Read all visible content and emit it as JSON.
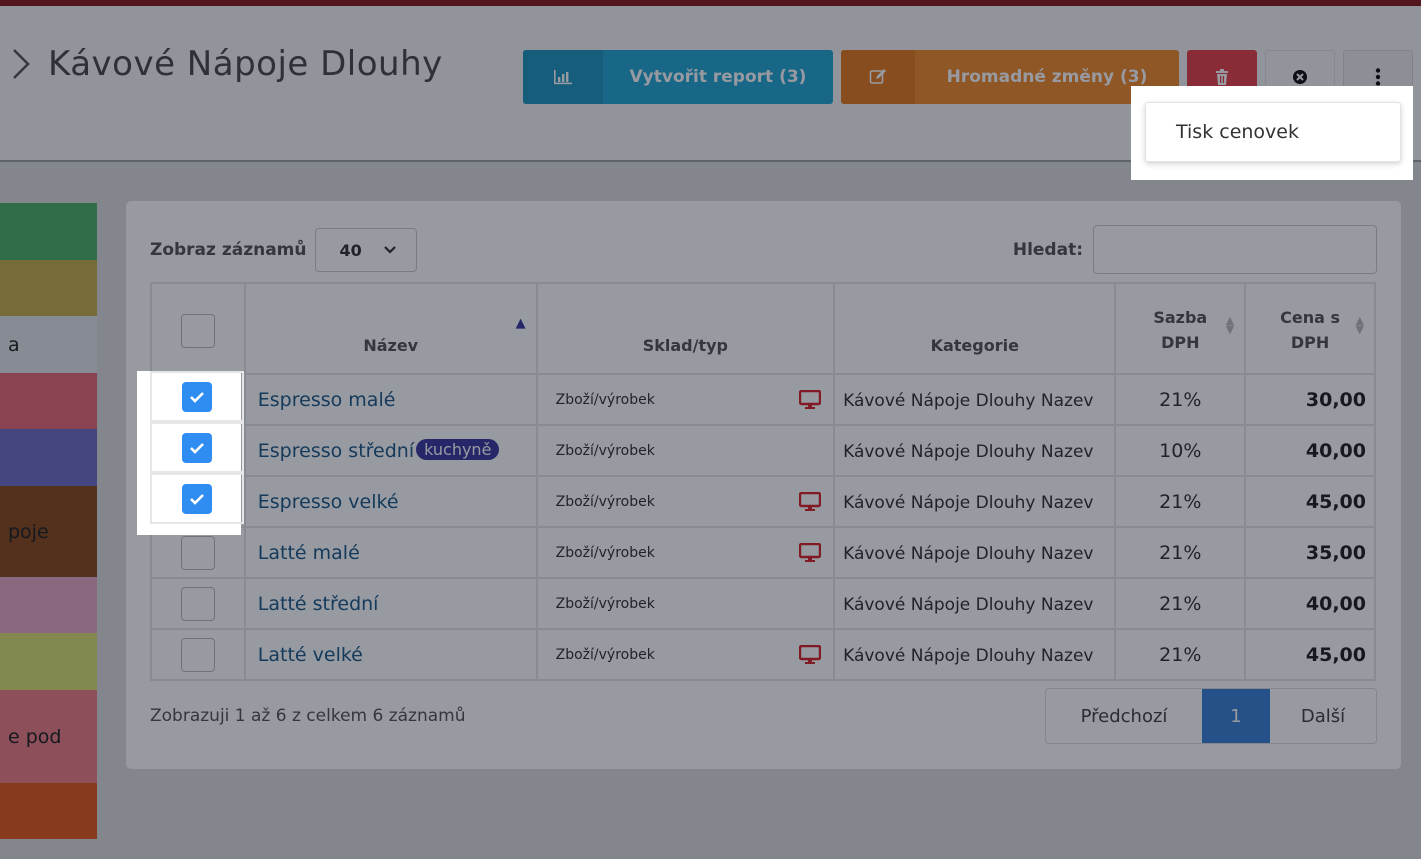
{
  "header": {
    "title": "Kávové Nápoje Dlouhy"
  },
  "toolbar": {
    "report_label": "Vytvořit report (3)",
    "bulk_label": "Hromadné změny (3)"
  },
  "dropdown": {
    "item": "Tisk cenovek"
  },
  "left_categories": [
    {
      "label": "",
      "color": "#4fb46a"
    },
    {
      "label": "",
      "color": "#c7b04a"
    },
    {
      "label": "a",
      "color": "#e4e6e8"
    },
    {
      "label": "",
      "color": "#e86b78"
    },
    {
      "label": "",
      "color": "#6e6fc6"
    },
    {
      "label": "poje",
      "color": "#8a4a1c"
    },
    {
      "label": "",
      "color": "#e9a9c3"
    },
    {
      "label": "",
      "color": "#dde073"
    },
    {
      "label": "e pod",
      "color": "#ee7f86"
    },
    {
      "label": "",
      "color": "#e45a20"
    }
  ],
  "table": {
    "show_label": "Zobraz záznamů",
    "show_value": "40",
    "search_label": "Hledat:",
    "columns": {
      "name": "Název",
      "sklad": "Sklad/typ",
      "kategorie": "Kategorie",
      "sazba": "Sazba DPH",
      "cena": "Cena s DPH"
    },
    "rows": [
      {
        "name": "Espresso malé",
        "badge": "",
        "sklad": "Zboží/výrobek",
        "monitor": true,
        "kategorie": "Kávové Nápoje Dlouhy Nazev",
        "sazba": "21%",
        "cena": "30,00",
        "checked": true
      },
      {
        "name": "Espresso střední",
        "badge": "kuchyně",
        "sklad": "Zboží/výrobek",
        "monitor": false,
        "kategorie": "Kávové Nápoje Dlouhy Nazev",
        "sazba": "10%",
        "cena": "40,00",
        "checked": true
      },
      {
        "name": "Espresso velké",
        "badge": "",
        "sklad": "Zboží/výrobek",
        "monitor": true,
        "kategorie": "Kávové Nápoje Dlouhy Nazev",
        "sazba": "21%",
        "cena": "45,00",
        "checked": true
      },
      {
        "name": "Latté malé",
        "badge": "",
        "sklad": "Zboží/výrobek",
        "monitor": true,
        "kategorie": "Kávové Nápoje Dlouhy Nazev",
        "sazba": "21%",
        "cena": "35,00",
        "checked": false
      },
      {
        "name": "Latté střední",
        "badge": "",
        "sklad": "Zboží/výrobek",
        "monitor": false,
        "kategorie": "Kávové Nápoje Dlouhy Nazev",
        "sazba": "21%",
        "cena": "40,00",
        "checked": false
      },
      {
        "name": "Latté velké",
        "badge": "",
        "sklad": "Zboží/výrobek",
        "monitor": true,
        "kategorie": "Kávové Nápoje Dlouhy Nazev",
        "sazba": "21%",
        "cena": "45,00",
        "checked": false
      }
    ],
    "info": "Zobrazuji 1 až 6 z celkem 6 záznamů",
    "pagination": {
      "prev": "Předchozí",
      "current": "1",
      "next": "Další"
    }
  },
  "colors": {
    "accent_link": "#1f5b8a",
    "report_button": "#25a8d3",
    "bulk_button": "#f28a2e",
    "delete_button": "#e8434a",
    "badge": "#3c3aa0",
    "monitor_icon": "#d9232b"
  },
  "icons": {
    "report": "bar-chart-icon",
    "bulk": "edit-icon",
    "delete": "trash-icon",
    "close": "circle-x-icon",
    "more": "vertical-dots-icon",
    "monitor": "monitor-icon"
  }
}
